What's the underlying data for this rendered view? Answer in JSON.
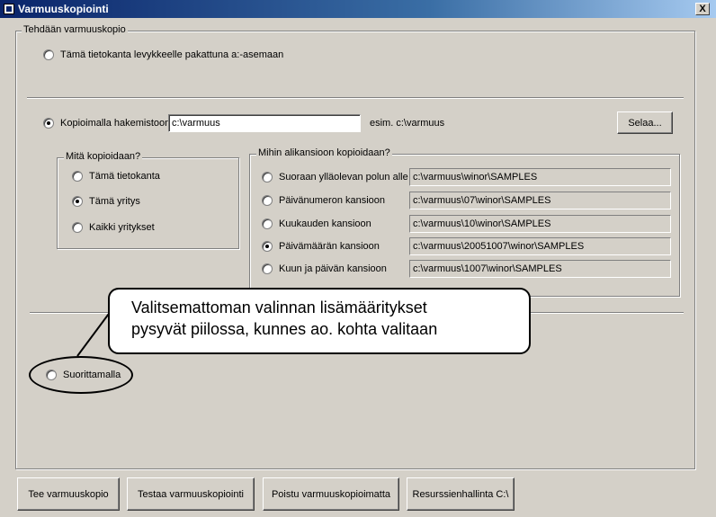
{
  "window": {
    "title": "Varmuuskopiointi",
    "close_glyph": "X",
    "icon": "app-icon"
  },
  "main_group": {
    "legend": "Tehdään varmuuskopio"
  },
  "option_floppy": {
    "label": "Tämä tietokanta levykkeelle pakattuna a:-asemaan",
    "checked": false
  },
  "option_directory": {
    "label": "Kopioimalla hakemistoon",
    "checked": true,
    "path_value": "c:\\varmuus",
    "example": "esim. c:\\varmuus",
    "browse_label": "Selaa..."
  },
  "what_group": {
    "legend": "Mitä kopioidaan?",
    "items": [
      {
        "label": "Tämä tietokanta",
        "checked": false
      },
      {
        "label": "Tämä yritys",
        "checked": true
      },
      {
        "label": "Kaikki yritykset",
        "checked": false
      }
    ]
  },
  "subfolder_group": {
    "legend": "Mihin alikansioon kopioidaan?",
    "items": [
      {
        "label": "Suoraan ylläolevan polun alle",
        "path": "c:\\varmuus\\winor\\SAMPLES",
        "checked": false
      },
      {
        "label": "Päivänumeron kansioon",
        "path": "c:\\varmuus\\07\\winor\\SAMPLES",
        "checked": false
      },
      {
        "label": "Kuukauden kansioon",
        "path": "c:\\varmuus\\10\\winor\\SAMPLES",
        "checked": false
      },
      {
        "label": "Päivämäärän kansioon",
        "path": "c:\\varmuus\\20051007\\winor\\SAMPLES",
        "checked": true
      },
      {
        "label": "Kuun ja päivän kansioon",
        "path": "c:\\varmuus\\1007\\winor\\SAMPLES",
        "checked": false
      }
    ]
  },
  "option_execute": {
    "label": "Suorittamalla",
    "checked": false
  },
  "callout": {
    "line1": "Valitsemattoman valinnan lisämääritykset",
    "line2": "pysyvät piilossa, kunnes ao. kohta valitaan"
  },
  "buttons": {
    "backup": "Tee varmuuskopio",
    "test": "Testaa varmuuskopiointi",
    "exit": "Poistu varmuuskopioimatta",
    "explorer": "Resurssienhallinta C:\\"
  }
}
